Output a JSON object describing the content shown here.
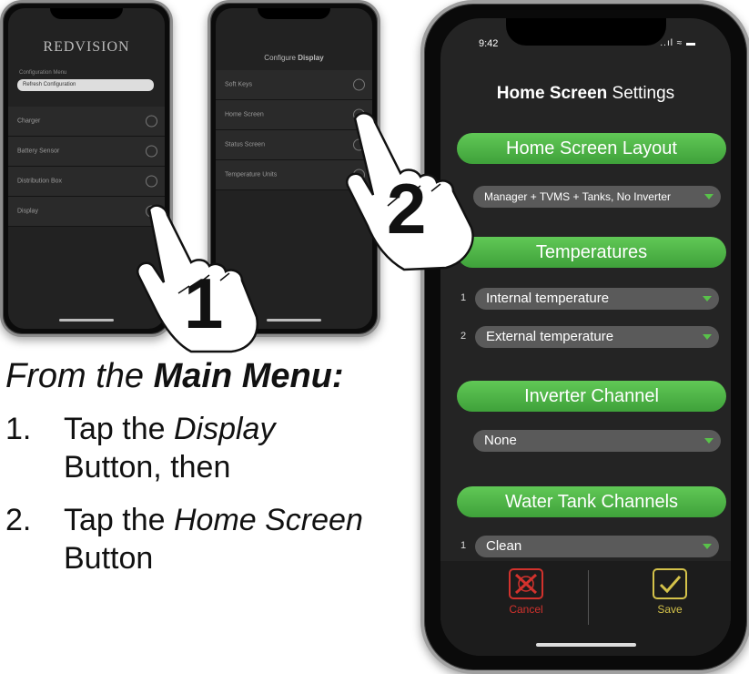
{
  "left_phone": {
    "logo": "REDVISION",
    "subtitle": "Configuration Menu",
    "field_value": "Refresh Configuration",
    "rows": [
      "Charger",
      "Battery Sensor",
      "Distribution Box",
      "Display"
    ]
  },
  "middle_phone": {
    "title_prefix": "Configure",
    "title_bold": "Display",
    "rows": [
      "Soft Keys",
      "Home Screen",
      "Status Screen",
      "Temperature Units"
    ]
  },
  "main_phone": {
    "time": "9:42",
    "status_icons": "..ıl ≈ ▬",
    "title_bold": "Home Screen",
    "title_rest": " Settings",
    "sections": {
      "layout": {
        "header": "Home Screen Layout",
        "value": "Manager + TVMS + Tanks, No Inverter"
      },
      "temperatures": {
        "header": "Temperatures",
        "items": [
          {
            "index": "1",
            "value": "Internal temperature"
          },
          {
            "index": "2",
            "value": "External temperature"
          }
        ]
      },
      "inverter": {
        "header": "Inverter Channel",
        "value": "None"
      },
      "water": {
        "header": "Water Tank Channels",
        "items": [
          {
            "index": "1",
            "value": "Clean"
          }
        ]
      }
    },
    "cancel_label": "Cancel",
    "save_label": "Save",
    "colors": {
      "accent_green": "#4cb846",
      "cancel_red": "#d2322d",
      "save_yellow": "#d4c24a"
    }
  },
  "steps": {
    "step1_marker": "1",
    "step2_marker": "2"
  },
  "instructions": {
    "heading_plain": "From the ",
    "heading_bold": "Main Menu:",
    "items": [
      {
        "num": "1.",
        "pre": "Tap the ",
        "em": "Display",
        "line2": "Button, then"
      },
      {
        "num": "2.",
        "pre": "Tap the ",
        "em": "Home Screen",
        "line2": "Button"
      }
    ]
  }
}
